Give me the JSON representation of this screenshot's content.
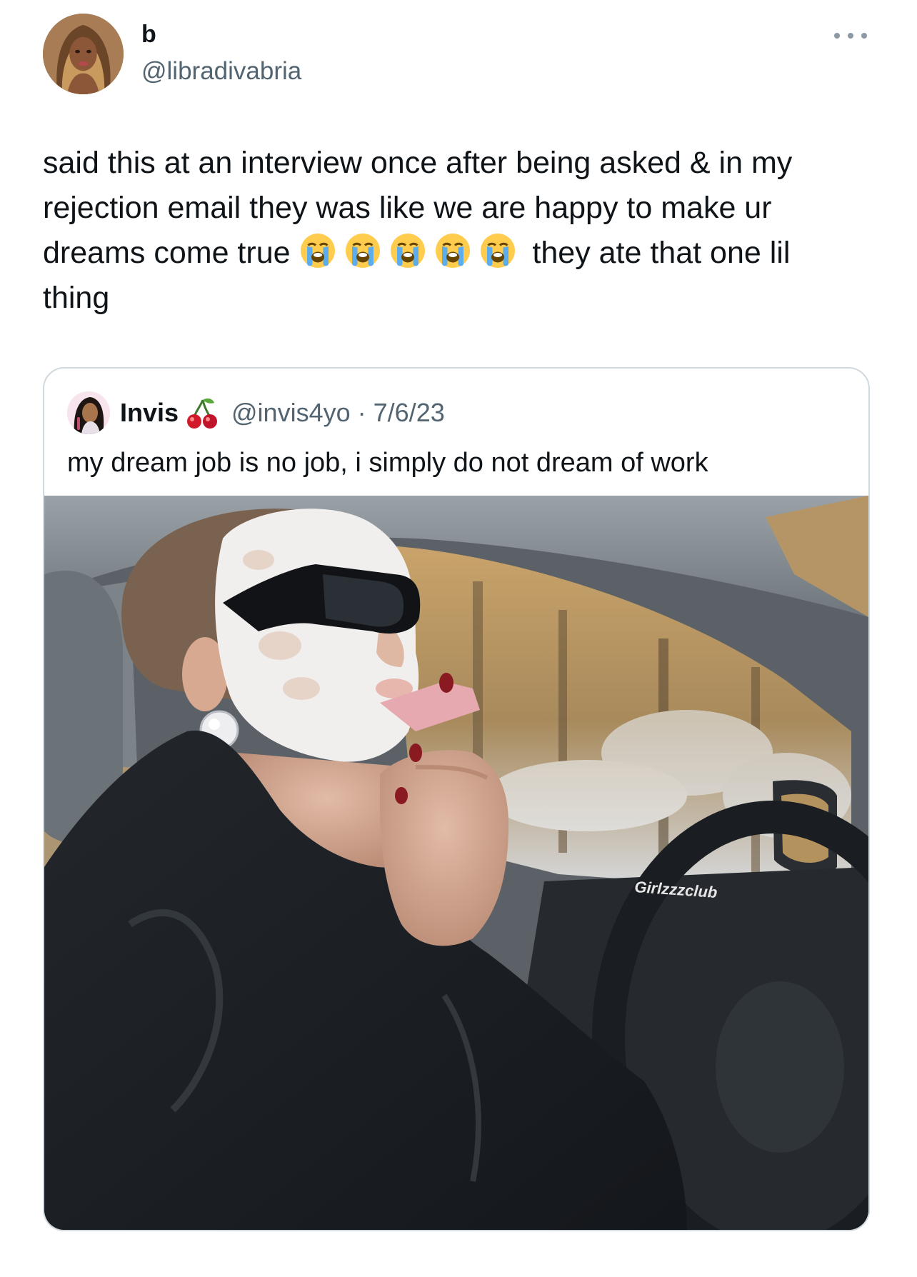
{
  "tweet": {
    "author": {
      "display_name": "b",
      "handle": "@libradivabria",
      "avatar_icon": "profile-photo"
    },
    "more_icon": "more-dots-icon",
    "text_parts": [
      "said this at an interview once after being asked & in my rejection email they was like we are happy to make ur dreams come true ",
      " they ate that one lil thing"
    ],
    "emoji": {
      "name": "loudly-crying-face-icon",
      "count": 5
    }
  },
  "quote": {
    "author": {
      "display_name": "Invis",
      "emoji_icon": "cherry-icon",
      "handle": "@invis4yo",
      "date": "7/6/23",
      "separator": "·"
    },
    "text": "my dream job is no job, i simply do not dream of work",
    "photo": {
      "watermark": "Girlzzzclub"
    }
  },
  "colors": {
    "text_primary": "#0f1419",
    "text_secondary": "#536471",
    "card_border": "#cfd9de"
  }
}
